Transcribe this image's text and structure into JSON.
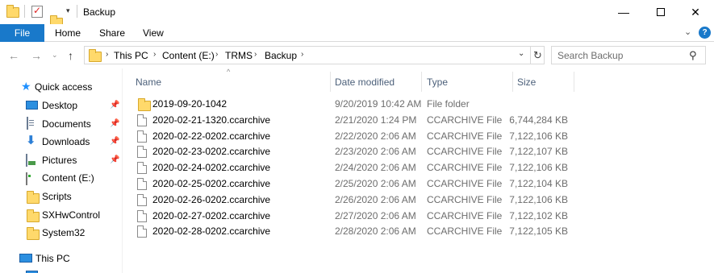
{
  "window": {
    "title": "Backup",
    "minimize_icon": "minimize-icon",
    "maximize_icon": "maximize-icon",
    "close_icon": "close-icon"
  },
  "ribbon": {
    "tabs": [
      "File",
      "Home",
      "Share",
      "View"
    ],
    "accent": "#1979ca"
  },
  "address": {
    "crumbs": [
      "This PC",
      "Content (E:)",
      "TRMS",
      "Backup"
    ]
  },
  "search": {
    "placeholder": "Search Backup"
  },
  "navpane": {
    "quick_access": "Quick access",
    "items": [
      {
        "label": "Desktop",
        "icon": "desktop-icon",
        "pinned": true
      },
      {
        "label": "Documents",
        "icon": "documents-icon",
        "pinned": true
      },
      {
        "label": "Downloads",
        "icon": "downloads-icon",
        "pinned": true
      },
      {
        "label": "Pictures",
        "icon": "pictures-icon",
        "pinned": true
      },
      {
        "label": "Content (E:)",
        "icon": "drive-icon",
        "pinned": false
      },
      {
        "label": "Scripts",
        "icon": "folder-icon",
        "pinned": false
      },
      {
        "label": "SXHwControl",
        "icon": "folder-icon",
        "pinned": false
      },
      {
        "label": "System32",
        "icon": "folder-icon",
        "pinned": false
      }
    ],
    "this_pc": "This PC"
  },
  "columns": {
    "name": "Name",
    "date": "Date modified",
    "type": "Type",
    "size": "Size"
  },
  "files": [
    {
      "name": "2019-09-20-1042",
      "date": "9/20/2019 10:42 AM",
      "type": "File folder",
      "size": "",
      "icon": "folder-icon"
    },
    {
      "name": "2020-02-21-1320.ccarchive",
      "date": "2/21/2020 1:24 PM",
      "type": "CCARCHIVE File",
      "size": "6,744,284 KB",
      "icon": "file-icon"
    },
    {
      "name": "2020-02-22-0202.ccarchive",
      "date": "2/22/2020 2:06 AM",
      "type": "CCARCHIVE File",
      "size": "7,122,106 KB",
      "icon": "file-icon"
    },
    {
      "name": "2020-02-23-0202.ccarchive",
      "date": "2/23/2020 2:06 AM",
      "type": "CCARCHIVE File",
      "size": "7,122,107 KB",
      "icon": "file-icon"
    },
    {
      "name": "2020-02-24-0202.ccarchive",
      "date": "2/24/2020 2:06 AM",
      "type": "CCARCHIVE File",
      "size": "7,122,106 KB",
      "icon": "file-icon"
    },
    {
      "name": "2020-02-25-0202.ccarchive",
      "date": "2/25/2020 2:06 AM",
      "type": "CCARCHIVE File",
      "size": "7,122,104 KB",
      "icon": "file-icon"
    },
    {
      "name": "2020-02-26-0202.ccarchive",
      "date": "2/26/2020 2:06 AM",
      "type": "CCARCHIVE File",
      "size": "7,122,106 KB",
      "icon": "file-icon"
    },
    {
      "name": "2020-02-27-0202.ccarchive",
      "date": "2/27/2020 2:06 AM",
      "type": "CCARCHIVE File",
      "size": "7,122,102 KB",
      "icon": "file-icon"
    },
    {
      "name": "2020-02-28-0202.ccarchive",
      "date": "2/28/2020 2:06 AM",
      "type": "CCARCHIVE File",
      "size": "7,122,105 KB",
      "icon": "file-icon"
    }
  ]
}
